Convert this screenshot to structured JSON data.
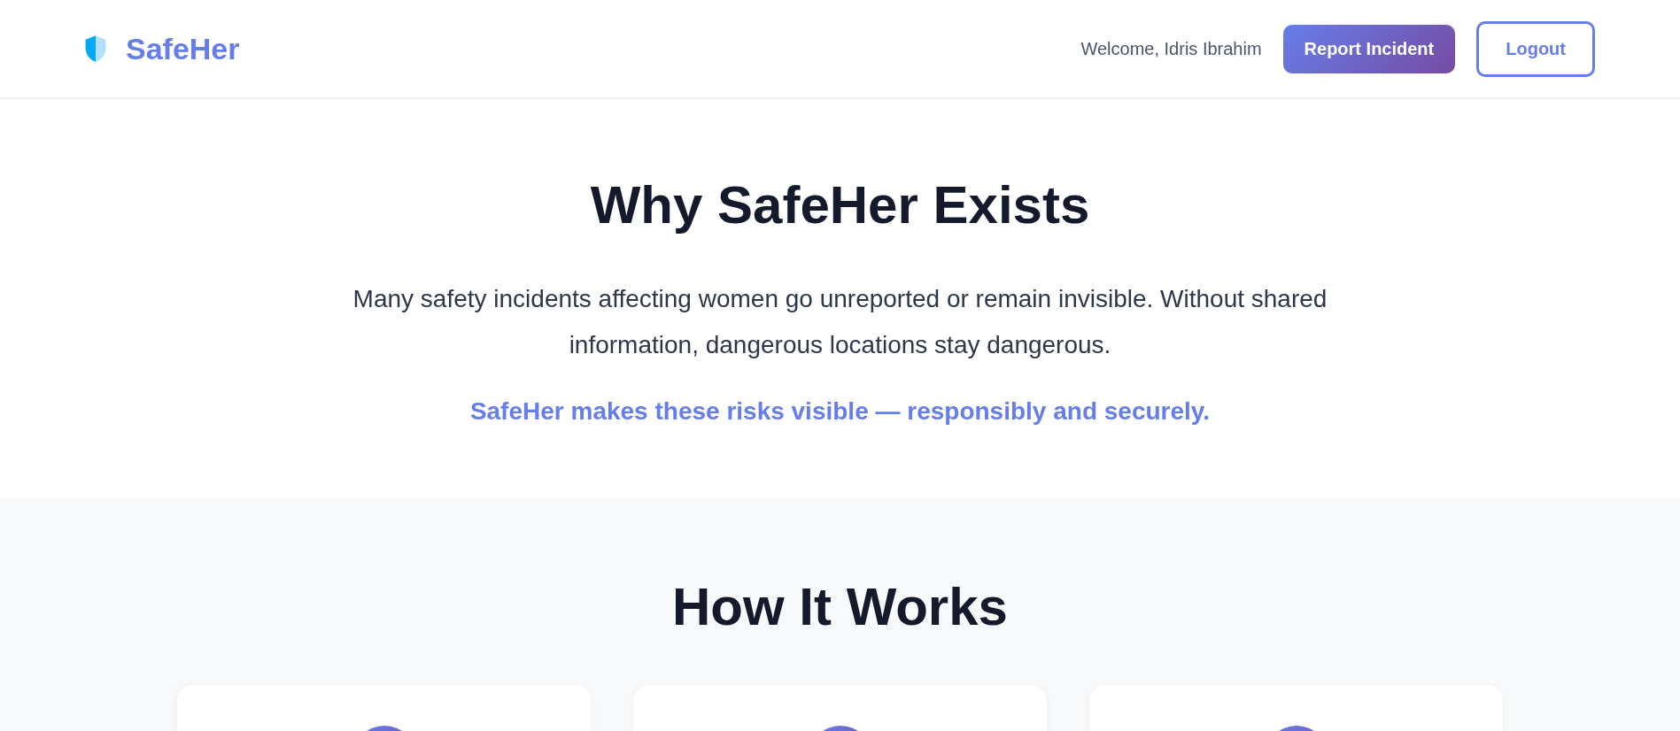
{
  "header": {
    "brand": "SafeHer",
    "welcome": "Welcome, Idris Ibrahim",
    "buttons": [
      {
        "label": "Report Incident",
        "kind": "primary"
      },
      {
        "label": "Logout",
        "kind": "outline"
      }
    ]
  },
  "hero": {
    "title": "Why SafeHer Exists",
    "text": "Many safety incidents affecting women go unreported or remain invisible. Without shared information, dangerous locations stay dangerous.",
    "tagline": "SafeHer makes these risks visible — responsibly and securely."
  },
  "how_it_works": {
    "title": "How It Works",
    "cards": [
      {
        "kind": "step"
      },
      {
        "kind": "step"
      },
      {
        "kind": "step"
      }
    ]
  }
}
